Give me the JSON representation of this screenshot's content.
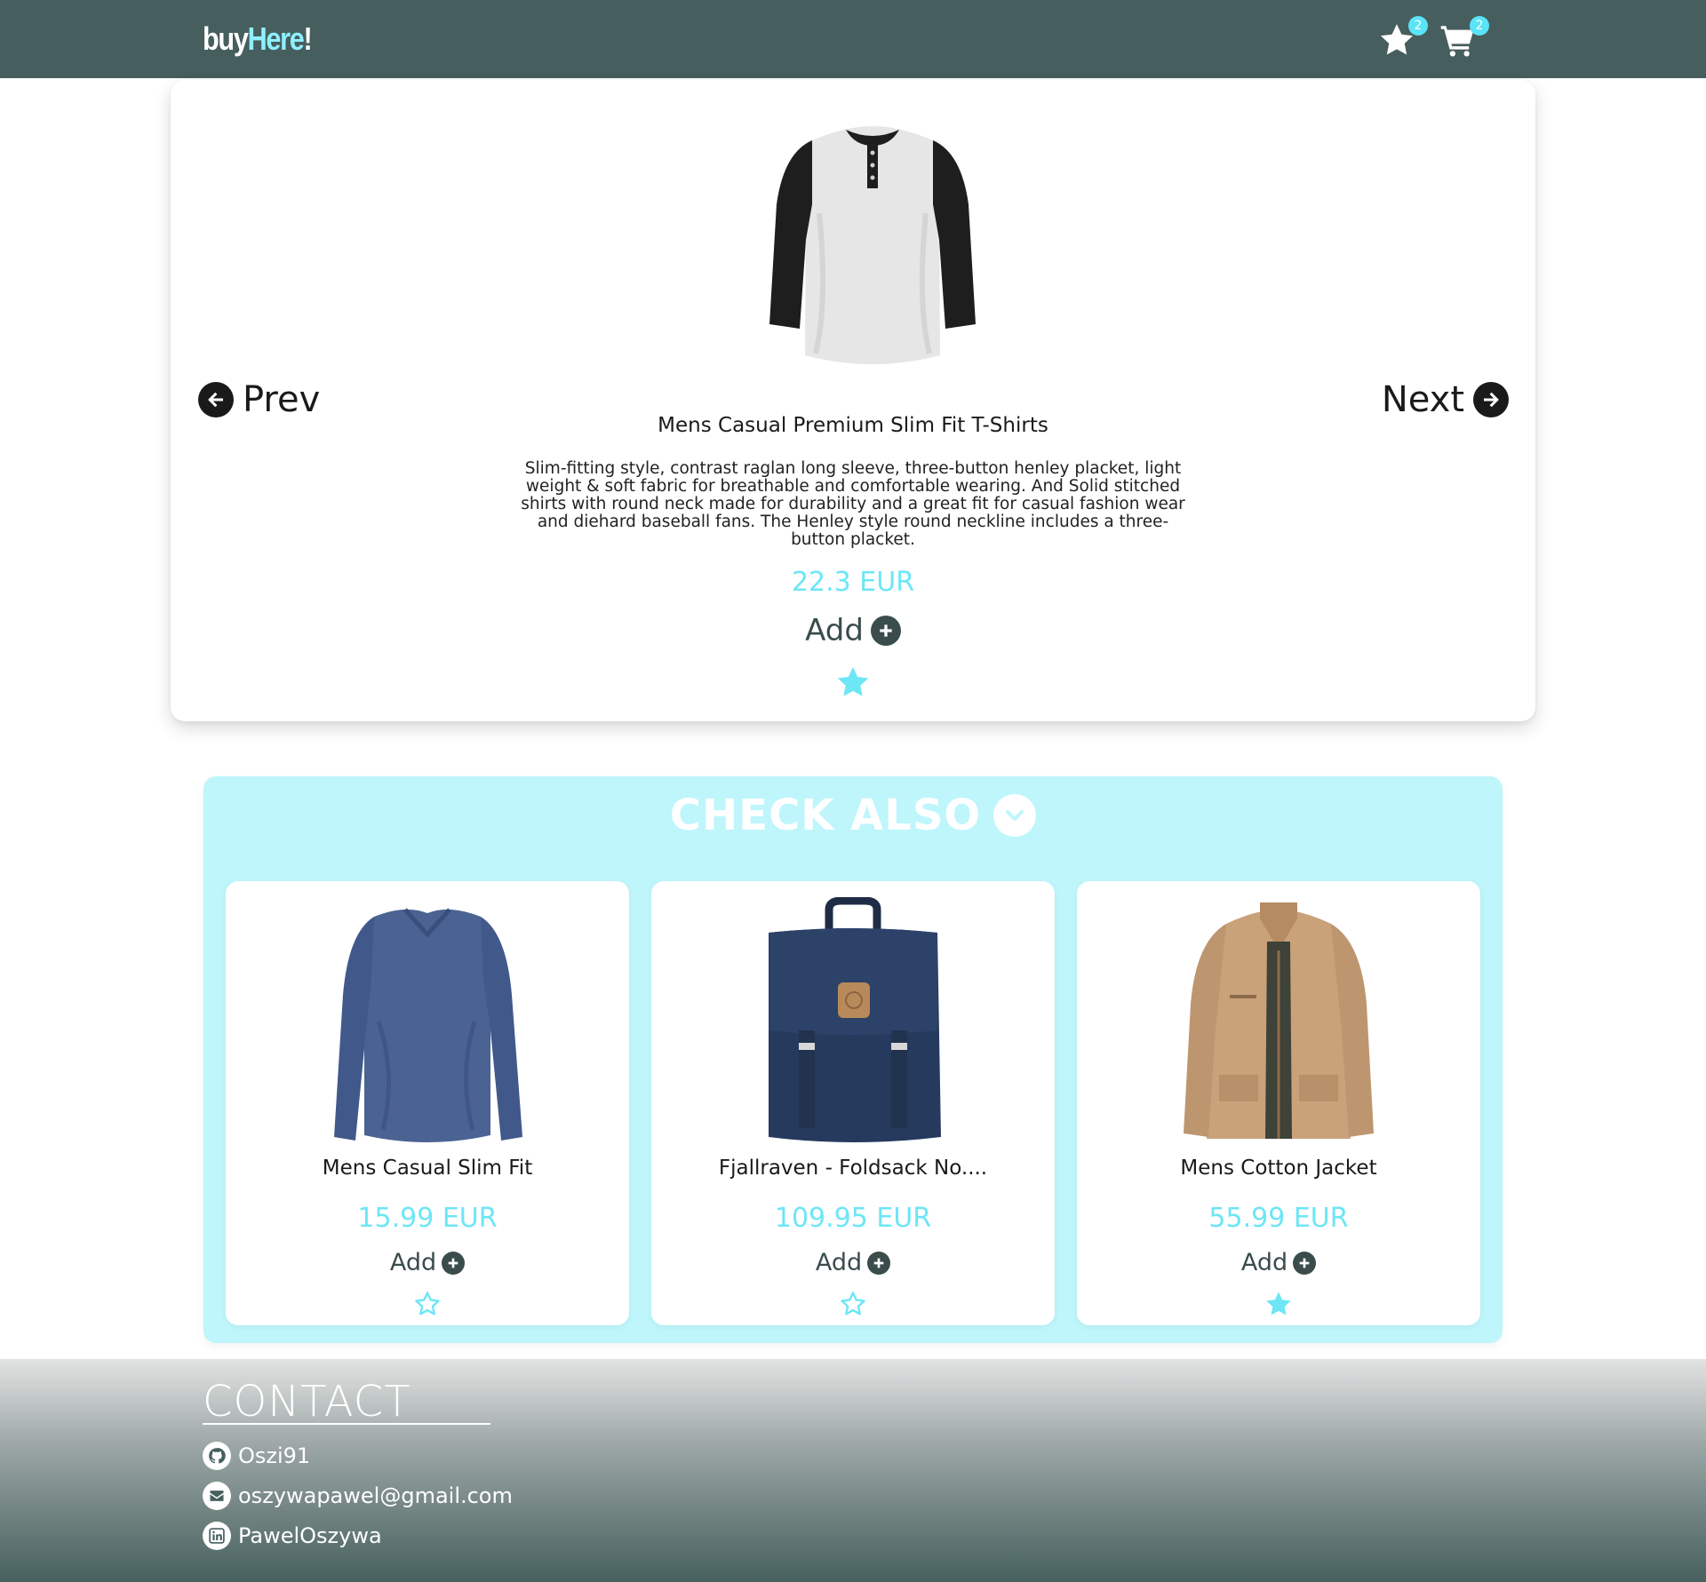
{
  "header": {
    "logo": {
      "part1": "buy",
      "part2": "Here",
      "part3": "!"
    },
    "favorites": {
      "icon": "star-icon",
      "count": "2"
    },
    "cart": {
      "icon": "cart-icon",
      "count": "2"
    },
    "colors": {
      "background": "#465e5d",
      "accent": "#8ef0ff",
      "badge": "#5ae4f7"
    }
  },
  "product": {
    "image": "henley-raglan-shirt",
    "prev_label": "Prev",
    "next_label": "Next",
    "title": "Mens Casual Premium Slim Fit T-Shirts",
    "description": "Slim-fitting style, contrast raglan long sleeve, three-button henley placket, light weight & soft fabric for breathable and comfortable wearing. And Solid stitched shirts with round neck made for durability and a great fit for casual fashion wear and diehard baseball fans. The Henley style round neckline includes a three-button placket.",
    "price": "22.3 EUR",
    "add_label": "Add",
    "favorite": true
  },
  "check_also": {
    "title": "CHECK ALSO",
    "background": "#bef6fc",
    "items": [
      {
        "image": "blue-longsleeve-shirt",
        "title": "Mens Casual Slim Fit",
        "price": "15.99 EUR",
        "add_label": "Add",
        "favorite": false
      },
      {
        "image": "navy-backpack",
        "title": "Fjallraven - Foldsack No....",
        "price": "109.95 EUR",
        "add_label": "Add",
        "favorite": false
      },
      {
        "image": "tan-cotton-jacket",
        "title": "Mens Cotton Jacket",
        "price": "55.99 EUR",
        "add_label": "Add",
        "favorite": true
      }
    ]
  },
  "footer": {
    "title": "CONTACT",
    "links": [
      {
        "icon": "github-icon",
        "label": "Oszi91"
      },
      {
        "icon": "envelope-icon",
        "label": "oszywapawel@gmail.com"
      },
      {
        "icon": "linkedin-icon",
        "label": "PawelOszywa"
      }
    ]
  }
}
